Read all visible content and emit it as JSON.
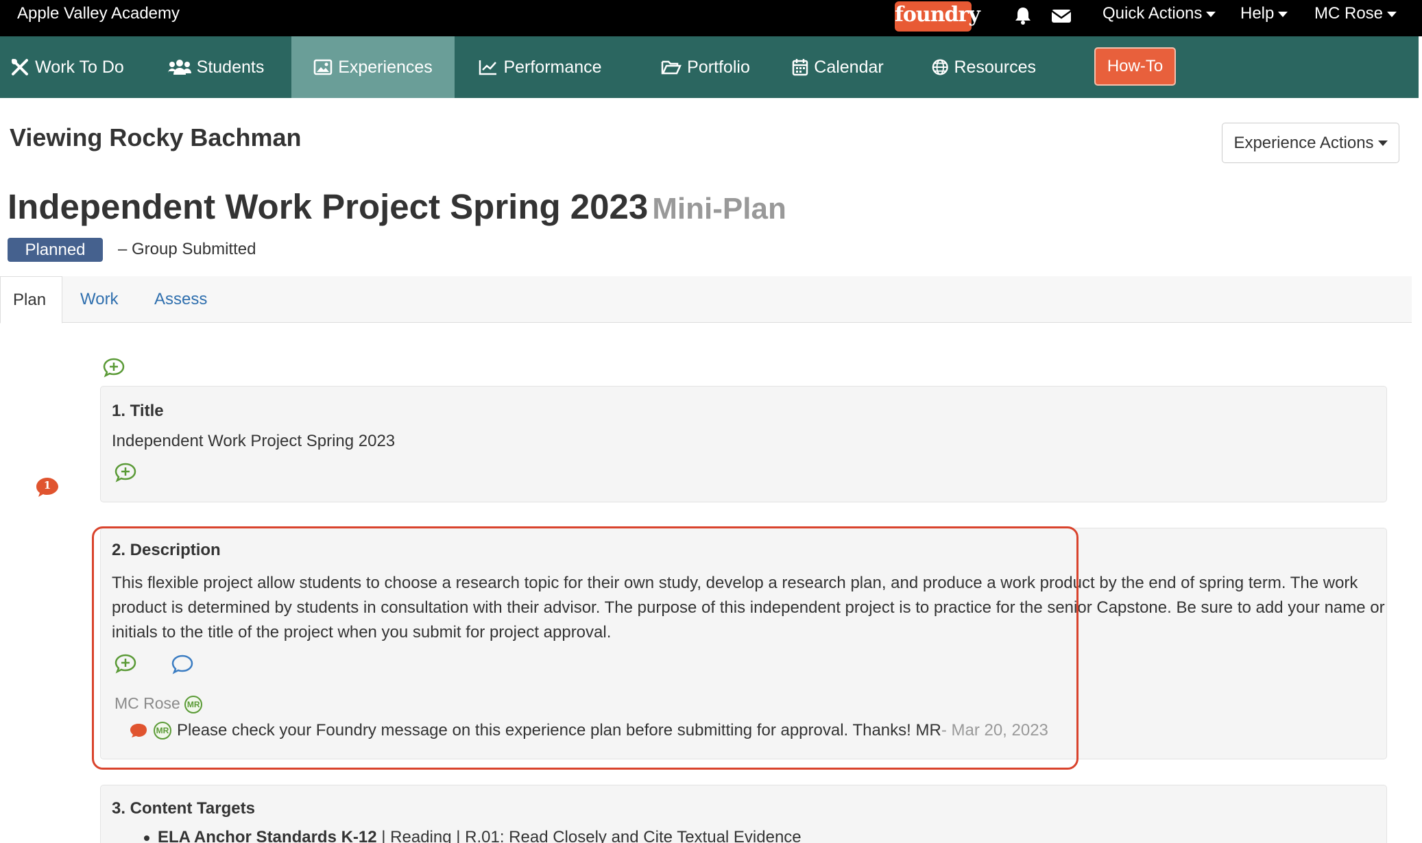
{
  "topbar": {
    "school_name": "Apple Valley Academy",
    "logo_text": "foundry",
    "quick_actions": "Quick Actions",
    "help": "Help",
    "user": "MC Rose"
  },
  "nav": {
    "items": [
      {
        "label": "Work To Do",
        "icon": "tools-icon"
      },
      {
        "label": "Students",
        "icon": "users-icon"
      },
      {
        "label": "Experiences",
        "icon": "image-icon"
      },
      {
        "label": "Performance",
        "icon": "line-chart-icon"
      },
      {
        "label": "Portfolio",
        "icon": "folder-open-icon"
      },
      {
        "label": "Calendar",
        "icon": "calendar-icon"
      },
      {
        "label": "Resources",
        "icon": "globe-icon"
      }
    ],
    "active": "Experiences",
    "howto_label": "How-To"
  },
  "page": {
    "viewing": "Viewing Rocky Bachman",
    "experience_actions": "Experience Actions",
    "title": "Independent Work Project Spring 2023",
    "subtitle": "Mini-Plan",
    "status_badge": "Planned",
    "status_note": "– Group Submitted"
  },
  "tabs": [
    "Plan",
    "Work",
    "Assess"
  ],
  "sections": {
    "title": {
      "heading": "1. Title",
      "text": "Independent Work Project Spring 2023",
      "comment_count": "1"
    },
    "description": {
      "heading": "2. Description",
      "lines": [
        "This flexible project allow students to choose a research topic for their own study, develop a research plan, and produce a work product by the end of spring term. The work",
        "product is determined by students in consultation with their advisor. The purpose of this independent project is to practice for the senior Capstone. Be sure to add your name or",
        "initials to the title of the project when you submit for project approval."
      ],
      "commenter": "MC Rose",
      "commenter_initials": "MR",
      "comment_text": "Please check your Foundry message on this experience plan before submitting for approval. Thanks! MR",
      "comment_date": " - Mar 20, 2023"
    },
    "content_targets": {
      "heading": "3. Content Targets",
      "bullet_bold": "ELA Anchor Standards K-12",
      "bullet_rest": " | Reading | R.01: Read Closely and Cite Textual Evidence"
    }
  },
  "colors": {
    "topbar": "#000000",
    "navbar": "#2b6660",
    "nav_active": "#6a9e98",
    "accent_orange": "#e8603c",
    "badge_blue": "#45618e",
    "add_green": "#5a9a36",
    "link_blue": "#2f6fae",
    "highlight_red": "#d9432c"
  }
}
